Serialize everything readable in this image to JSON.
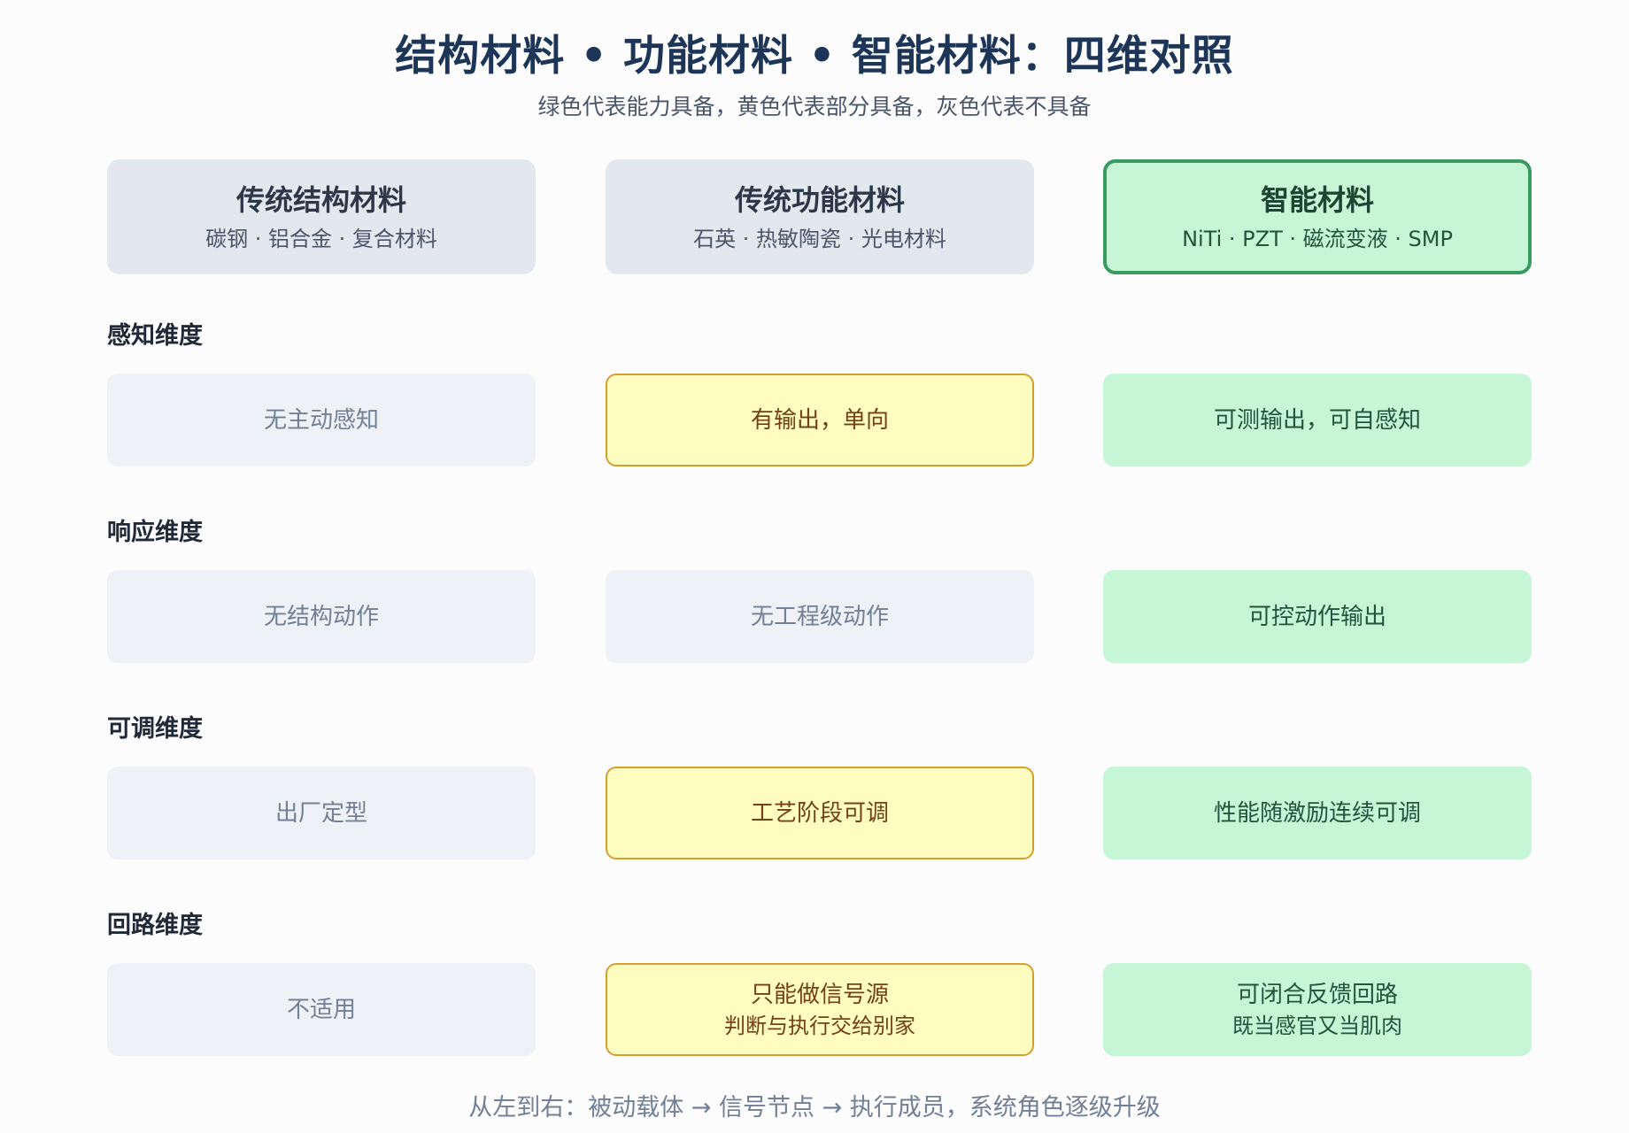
{
  "title": "结构材料 • 功能材料 • 智能材料：四维对照",
  "subtitle": "绿色代表能力具备，黄色代表部分具备，灰色代表不具备",
  "columns": [
    {
      "name": "传统结构材料",
      "examples": "碳钢 · 铝合金 · 复合材料"
    },
    {
      "name": "传统功能材料",
      "examples": "石英 · 热敏陶瓷 · 光电材料"
    },
    {
      "name": "智能材料",
      "examples": "NiTi · PZT · 磁流变液 · SMP"
    }
  ],
  "dimensions": [
    {
      "label": "感知维度",
      "cells": [
        {
          "level": "gray",
          "text": "无主动感知",
          "sub": ""
        },
        {
          "level": "yellow",
          "text": "有输出，单向",
          "sub": ""
        },
        {
          "level": "green",
          "text": "可测输出，可自感知",
          "sub": ""
        }
      ]
    },
    {
      "label": "响应维度",
      "cells": [
        {
          "level": "gray",
          "text": "无结构动作",
          "sub": ""
        },
        {
          "level": "gray",
          "text": "无工程级动作",
          "sub": ""
        },
        {
          "level": "green",
          "text": "可控动作输出",
          "sub": ""
        }
      ]
    },
    {
      "label": "可调维度",
      "cells": [
        {
          "level": "gray",
          "text": "出厂定型",
          "sub": ""
        },
        {
          "level": "yellow",
          "text": "工艺阶段可调",
          "sub": ""
        },
        {
          "level": "green",
          "text": "性能随激励连续可调",
          "sub": ""
        }
      ]
    },
    {
      "label": "回路维度",
      "cells": [
        {
          "level": "gray",
          "text": "不适用",
          "sub": ""
        },
        {
          "level": "yellow",
          "text": "只能做信号源",
          "sub": "判断与执行交给别家"
        },
        {
          "level": "green",
          "text": "可闭合反馈回路",
          "sub": "既当感官又当肌肉"
        }
      ]
    }
  ],
  "footer": "从左到右：被动载体 → 信号节点 → 执行成员，系统角色逐级升级",
  "colors": {
    "green_fill": "#c6f6d5",
    "green_border": "#3a9a62",
    "yellow_fill": "#fefcbf",
    "yellow_border": "#d69e2e",
    "gray_fill": "#eef2f6",
    "header_fill": "#e3e8ef"
  }
}
